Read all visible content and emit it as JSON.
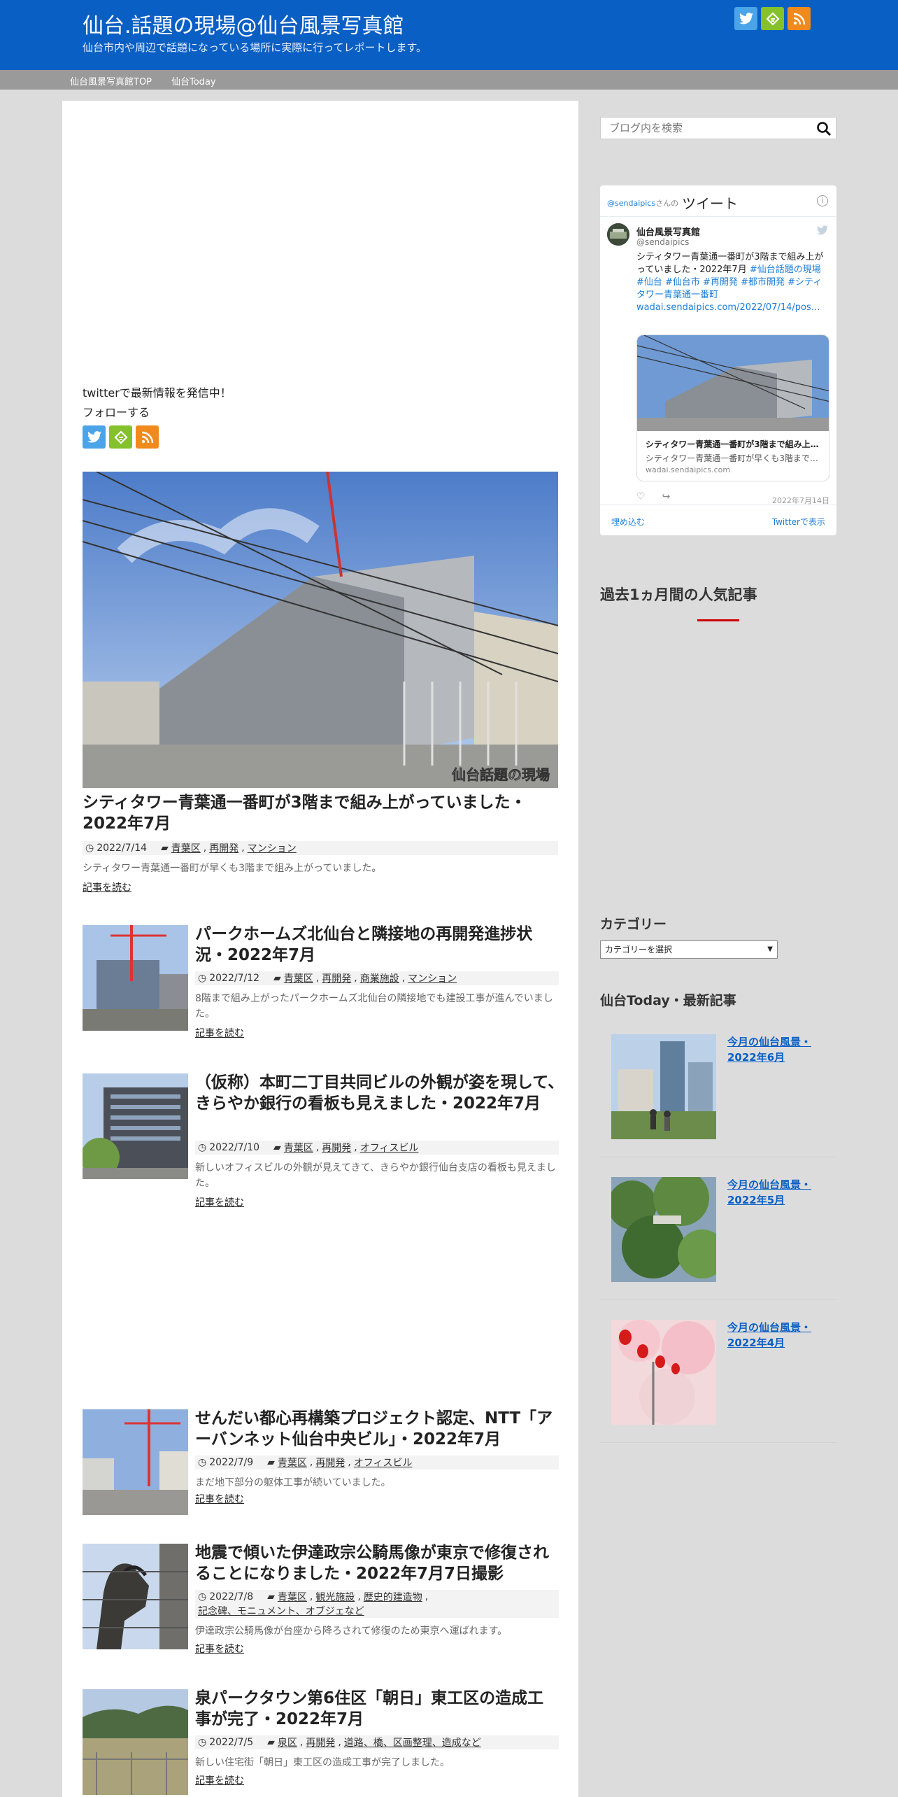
{
  "header": {
    "title": "仙台.話題の現場@仙台風景写真館",
    "description": "仙台市内や周辺で話題になっている場所に実際に行ってレポートします。",
    "icons": [
      "twitter-icon",
      "feedly-icon",
      "rss-icon"
    ]
  },
  "nav": {
    "items": [
      {
        "label": "仙台風景写真館TOP"
      },
      {
        "label": "仙台Today"
      }
    ]
  },
  "follow": {
    "line1": "twitterで最新情報を発信中！",
    "line2": "フォローする"
  },
  "posts": [
    {
      "title": "シティタワー青葉通一番町が3階まで組み上がっていました・2022年7月",
      "date": "2022/7/14",
      "categories": [
        "青葉区",
        "再開発",
        "マンション"
      ],
      "excerpt": "シティタワー青葉通一番町が早くも3階まで組み上がっていました。",
      "readmore": "記事を読む",
      "watermark": "仙台話題の現場"
    },
    {
      "title": "パークホームズ北仙台と隣接地の再開発進捗状況・2022年7月",
      "date": "2022/7/12",
      "categories": [
        "青葉区",
        "再開発",
        "商業施設",
        "マンション"
      ],
      "excerpt": "8階まで組み上がったパークホームズ北仙台の隣接地でも建設工事が進んでいました。",
      "readmore": "記事を読む"
    },
    {
      "title": "（仮称）本町二丁目共同ビルの外観が姿を現して、きらやか銀行の看板も見えました・2022年7月",
      "date": "2022/7/10",
      "categories": [
        "青葉区",
        "再開発",
        "オフィスビル"
      ],
      "excerpt": "新しいオフィスビルの外観が見えてきて、きらやか銀行仙台支店の看板も見えました。",
      "readmore": "記事を読む"
    },
    {
      "title": "せんだい都心再構築プロジェクト認定、NTT「アーバンネット仙台中央ビル」・2022年7月",
      "date": "2022/7/9",
      "categories": [
        "青葉区",
        "再開発",
        "オフィスビル"
      ],
      "excerpt": "まだ地下部分の躯体工事が続いていました。",
      "readmore": "記事を読む"
    },
    {
      "title": "地震で傾いた伊達政宗公騎馬像が東京で修復されることになりました・2022年7月7日撮影",
      "date": "2022/7/8",
      "categories": [
        "青葉区",
        "観光施設",
        "歴史的建造物",
        "記念碑、モニュメント、オブジェなど"
      ],
      "excerpt": "伊達政宗公騎馬像が台座から降ろされて修復のため東京へ運ばれます。",
      "readmore": "記事を読む"
    },
    {
      "title": "泉パークタウン第6住区「朝日」東工区の造成工事が完了・2022年7月",
      "date": "2022/7/5",
      "categories": [
        "泉区",
        "再開発",
        "道路、橋、区画整理、造成など"
      ],
      "excerpt": "新しい住宅街「朝日」東工区の造成工事が完了しました。",
      "readmore": "記事を読む"
    }
  ],
  "sidebar": {
    "search_placeholder": "ブログ内を検索",
    "tweet": {
      "handle_top": "@sendaipics",
      "handle_suffix": "さんの",
      "title": "ツイート",
      "name": "仙台風景写真館",
      "user": "@sendaipics",
      "text_plain": "シティタワー青葉通一番町が3階まで組み上がっていました・2022年7月 ",
      "text_tags": "#仙台話題の現場 #仙台 #仙台市 #再開発 #都市開発 #シティタワー青葉通一番町",
      "text_link": "wadai.sendaipics.com/2022/07/14/pos…",
      "card_title": "シティタワー青葉通一番町が3階まで組み上…",
      "card_desc": "シティタワー青葉通一番町が早くも3階まで…",
      "card_domain": "wadai.sendaipics.com",
      "date": "2022年7月14日",
      "embed": "埋め込む",
      "view": "Twitterで表示"
    },
    "popular_heading": "過去1ヵ月間の人気記事",
    "category_heading": "カテゴリー",
    "category_select": "カテゴリーを選択",
    "today_heading": "仙台Today・最新記事",
    "today_items": [
      {
        "title": "今月の仙台風景・2022年6月"
      },
      {
        "title": "今月の仙台風景・2022年5月"
      },
      {
        "title": "今月の仙台風景・2022年4月"
      }
    ]
  }
}
